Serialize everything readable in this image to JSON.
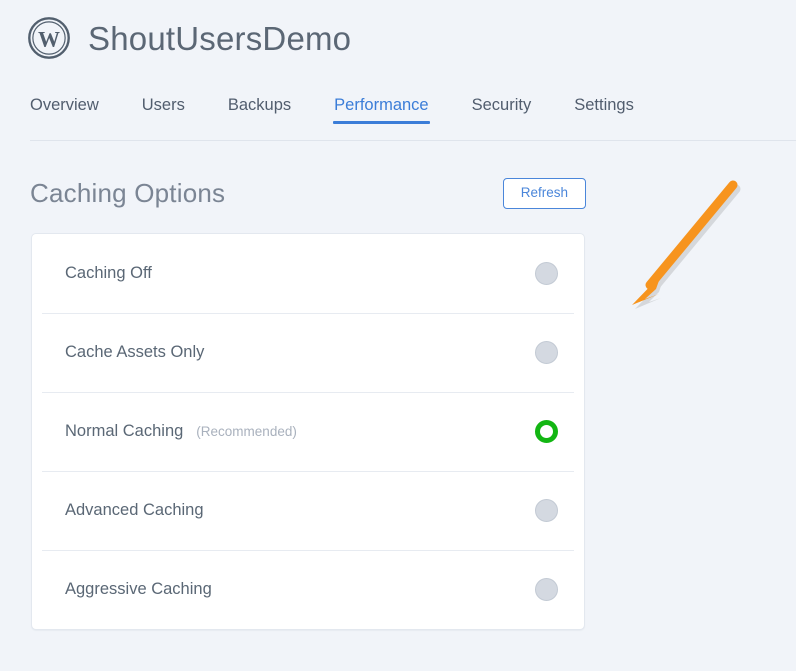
{
  "header": {
    "logo_icon": "wordpress-logo-icon",
    "site_title": "ShoutUsersDemo"
  },
  "nav": {
    "tabs": [
      {
        "label": "Overview",
        "active": false
      },
      {
        "label": "Users",
        "active": false
      },
      {
        "label": "Backups",
        "active": false
      },
      {
        "label": "Performance",
        "active": true
      },
      {
        "label": "Security",
        "active": false
      },
      {
        "label": "Settings",
        "active": false
      }
    ]
  },
  "section": {
    "title": "Caching Options",
    "refresh_label": "Refresh"
  },
  "caching_options": [
    {
      "label": "Caching Off",
      "note": "",
      "selected": false
    },
    {
      "label": "Cache Assets Only",
      "note": "",
      "selected": false
    },
    {
      "label": "Normal Caching",
      "note": "(Recommended)",
      "selected": true
    },
    {
      "label": "Advanced Caching",
      "note": "",
      "selected": false
    },
    {
      "label": "Aggressive Caching",
      "note": "",
      "selected": false
    }
  ],
  "annotation": {
    "arrow_icon": "arrow-down-left-icon",
    "arrow_color": "#f7941e"
  },
  "colors": {
    "page_background": "#f1f4f9",
    "accent_blue": "#3b7dd8",
    "selected_green": "#13b613",
    "text_slate": "#5a6775",
    "muted_gray": "#a9b1bd"
  }
}
